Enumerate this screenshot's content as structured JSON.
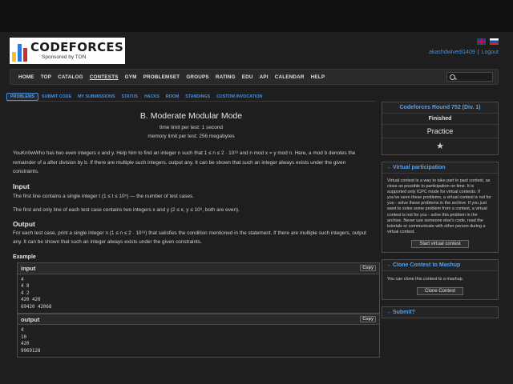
{
  "brand": {
    "name_code": "CODE",
    "name_forces": "FORCES",
    "sponsor": "Sponsored by TON",
    "bar_colors": [
      "#f2c028",
      "#2c7be5",
      "#c9302c"
    ]
  },
  "user": {
    "handle": "akashdwivedi1409",
    "separator": "|",
    "logout": "Logout"
  },
  "nav": {
    "items": [
      "HOME",
      "TOP",
      "CATALOG",
      "CONTESTS",
      "GYM",
      "PROBLEMSET",
      "GROUPS",
      "RATING",
      "EDU",
      "API",
      "CALENDAR",
      "HELP"
    ],
    "active": "CONTESTS"
  },
  "subtabs": [
    "PROBLEMS",
    "SUBMIT CODE",
    "MY SUBMISSIONS",
    "STATUS",
    "HACKS",
    "ROOM",
    "STANDINGS",
    "CUSTOM INVOCATION"
  ],
  "problem": {
    "title": "B. Moderate Modular Mode",
    "time_limit": "time limit per test: 1 second",
    "memory_limit": "memory limit per test: 256 megabytes",
    "statement": "YouKn0wWho has two even integers x and y. Help him to find an integer n such that 1 ≤ n ≤ 2 · 10¹⁸ and n mod x = y mod n. Here, a mod b denotes the remainder of a after division by b. If there are multiple such integers, output any. It can be shown that such an integer always exists under the given constraints.",
    "input_title": "Input",
    "input_line1": "The first line contains a single integer t (1 ≤ t ≤ 10⁵) — the number of test cases.",
    "input_line2": "The first and only line of each test case contains two integers x and y (2 ≤ x, y ≤ 10⁹, both are even).",
    "output_title": "Output",
    "output_text": "For each test case, print a single integer n (1 ≤ n ≤ 2 · 10¹⁸) that satisfies the condition mentioned in the statement. If there are multiple such integers, output any. It can be shown that such an integer always exists under the given constraints.",
    "example_title": "Example",
    "input_label": "input",
    "output_label": "output",
    "copy_label": "Copy",
    "sample_input": "4\n4 8\n4 2\n420 420\n69420 42068",
    "sample_output": "4\n10\n420\n9969128"
  },
  "sidebar": {
    "round_title": "Codeforces Round 752 (Div. 1)",
    "status": "Finished",
    "mode": "Practice",
    "star": "★",
    "virtual_title": "→ Virtual participation",
    "virtual_text": "Virtual contest is a way to take part in past contest, as close as possible to participation on time. It is supported only ICPC mode for virtual contests. If you've seen these problems, a virtual contest is not for you - solve these problems in the archive. If you just want to solve some problem from a contest, a virtual contest is not for you - solve this problem in the archive. Never use someone else's code, read the tutorials or communicate with other person during a virtual contest.",
    "virtual_button": "Start virtual contest",
    "clone_title": "→ Clone Contest to Mashup",
    "clone_text": "You can clone this contest to a mashup.",
    "clone_button": "Clone Contest",
    "submit_title": "→ Submit?"
  }
}
